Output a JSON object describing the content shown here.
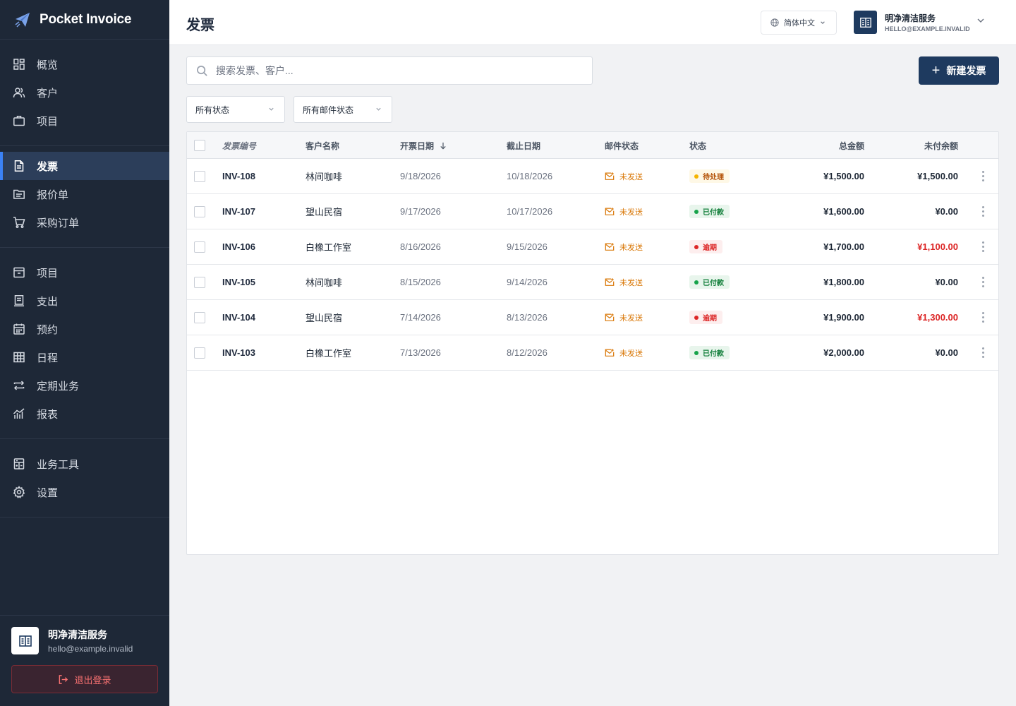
{
  "brand": {
    "name": "Pocket Invoice"
  },
  "sidebar": {
    "groups": [
      [
        {
          "label": "概览",
          "icon": "dashboard-icon"
        },
        {
          "label": "客户",
          "icon": "users-icon"
        },
        {
          "label": "项目",
          "icon": "briefcase-icon"
        }
      ],
      [
        {
          "label": "发票",
          "icon": "document-icon",
          "active": true
        },
        {
          "label": "报价单",
          "icon": "folder-icon"
        },
        {
          "label": "采购订单",
          "icon": "cart-icon"
        }
      ],
      [
        {
          "label": "项目",
          "icon": "archive-icon"
        },
        {
          "label": "支出",
          "icon": "receipt-icon"
        },
        {
          "label": "预约",
          "icon": "calendar-icon"
        },
        {
          "label": "日程",
          "icon": "grid-icon"
        },
        {
          "label": "定期业务",
          "icon": "repeat-icon"
        },
        {
          "label": "报表",
          "icon": "chart-icon"
        }
      ],
      [
        {
          "label": "业务工具",
          "icon": "calculator-icon"
        },
        {
          "label": "设置",
          "icon": "gear-icon"
        }
      ]
    ],
    "footer": {
      "name": "明净清洁服务",
      "email": "hello@example.invalid",
      "logout_label": "退出登录"
    }
  },
  "header": {
    "title": "发票",
    "language": "简体中文",
    "account_name": "明净清洁服务",
    "account_email": "HELLO@EXAMPLE.INVALID"
  },
  "toolbar": {
    "search_placeholder": "搜索发票、客户...",
    "new_button_label": "新建发票",
    "filter_status": "所有状态",
    "filter_mail": "所有邮件状态"
  },
  "table": {
    "headers": {
      "number": "发票编号",
      "customer": "客户名称",
      "issue_date": "开票日期",
      "due_date": "截止日期",
      "mail_status": "邮件状态",
      "status": "状态",
      "total": "总金额",
      "balance": "未付余额"
    },
    "rows": [
      {
        "number": "INV-108",
        "customer": "林间咖啡",
        "issue_date": "9/18/2026",
        "due_date": "10/18/2026",
        "mail_status": "未发送",
        "status": "待处理",
        "status_type": "pending",
        "total": "¥1,500.00",
        "balance": "¥1,500.00",
        "balance_overdue": false
      },
      {
        "number": "INV-107",
        "customer": "望山民宿",
        "issue_date": "9/17/2026",
        "due_date": "10/17/2026",
        "mail_status": "未发送",
        "status": "已付款",
        "status_type": "paid",
        "total": "¥1,600.00",
        "balance": "¥0.00",
        "balance_overdue": false
      },
      {
        "number": "INV-106",
        "customer": "白橡工作室",
        "issue_date": "8/16/2026",
        "due_date": "9/15/2026",
        "mail_status": "未发送",
        "status": "逾期",
        "status_type": "overdue",
        "total": "¥1,700.00",
        "balance": "¥1,100.00",
        "balance_overdue": true
      },
      {
        "number": "INV-105",
        "customer": "林间咖啡",
        "issue_date": "8/15/2026",
        "due_date": "9/14/2026",
        "mail_status": "未发送",
        "status": "已付款",
        "status_type": "paid",
        "total": "¥1,800.00",
        "balance": "¥0.00",
        "balance_overdue": false
      },
      {
        "number": "INV-104",
        "customer": "望山民宿",
        "issue_date": "7/14/2026",
        "due_date": "8/13/2026",
        "mail_status": "未发送",
        "status": "逾期",
        "status_type": "overdue",
        "total": "¥1,900.00",
        "balance": "¥1,300.00",
        "balance_overdue": true
      },
      {
        "number": "INV-103",
        "customer": "白橡工作室",
        "issue_date": "7/13/2026",
        "due_date": "8/12/2026",
        "mail_status": "未发送",
        "status": "已付款",
        "status_type": "paid",
        "total": "¥2,000.00",
        "balance": "¥0.00",
        "balance_overdue": false
      }
    ]
  },
  "colors": {
    "sidebar_bg": "#1e2837",
    "accent": "#1e3a5f",
    "active_indicator": "#3b82f6",
    "overdue": "#dc2626",
    "paid": "#16a34a",
    "pending": "#f5b400",
    "mail_unsent": "#d97706"
  }
}
